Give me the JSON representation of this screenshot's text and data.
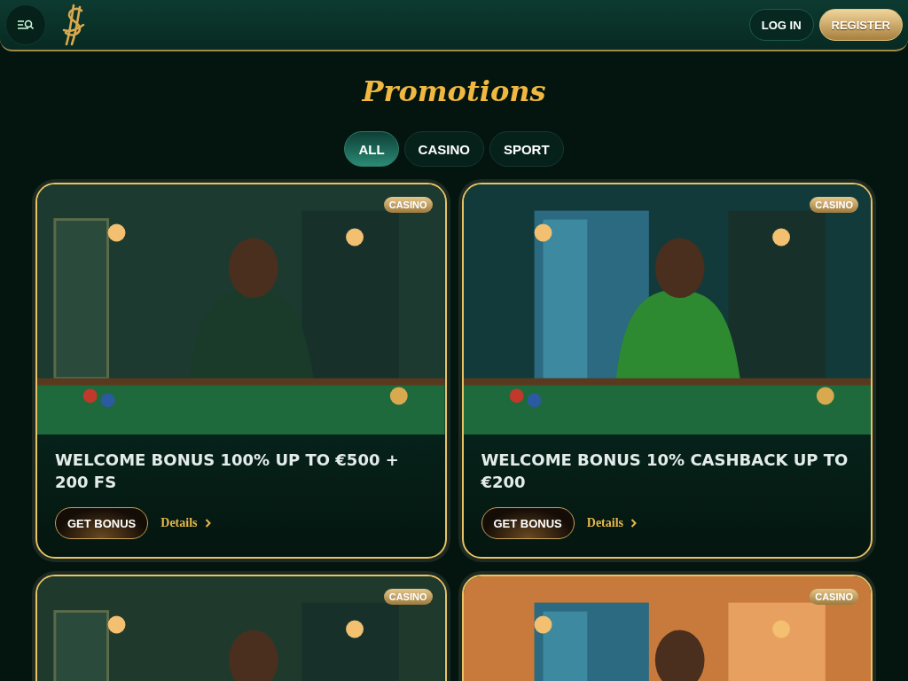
{
  "header": {
    "buttons": [
      {
        "label": "LOG IN",
        "kind": "outline"
      },
      {
        "label": "REGISTER",
        "kind": "gold"
      }
    ]
  },
  "title": "Promotions",
  "tabs": [
    {
      "label": "ALL",
      "selected": true
    },
    {
      "label": "CASINO",
      "selected": false
    },
    {
      "label": "SPORT",
      "selected": false
    }
  ],
  "promotions": [
    {
      "badge": "CASINO",
      "title": "WELCOME BONUS 100% UP TO €500 + 200 FS",
      "button": "GET BONUS",
      "link": "Details"
    },
    {
      "badge": "CASINO",
      "title": "WELCOME BONUS 10% CASHBACK UP TO €200",
      "button": "GET BONUS",
      "link": "Details"
    },
    {
      "badge": "CASINO"
    },
    {
      "badge": "CASINO"
    }
  ]
}
